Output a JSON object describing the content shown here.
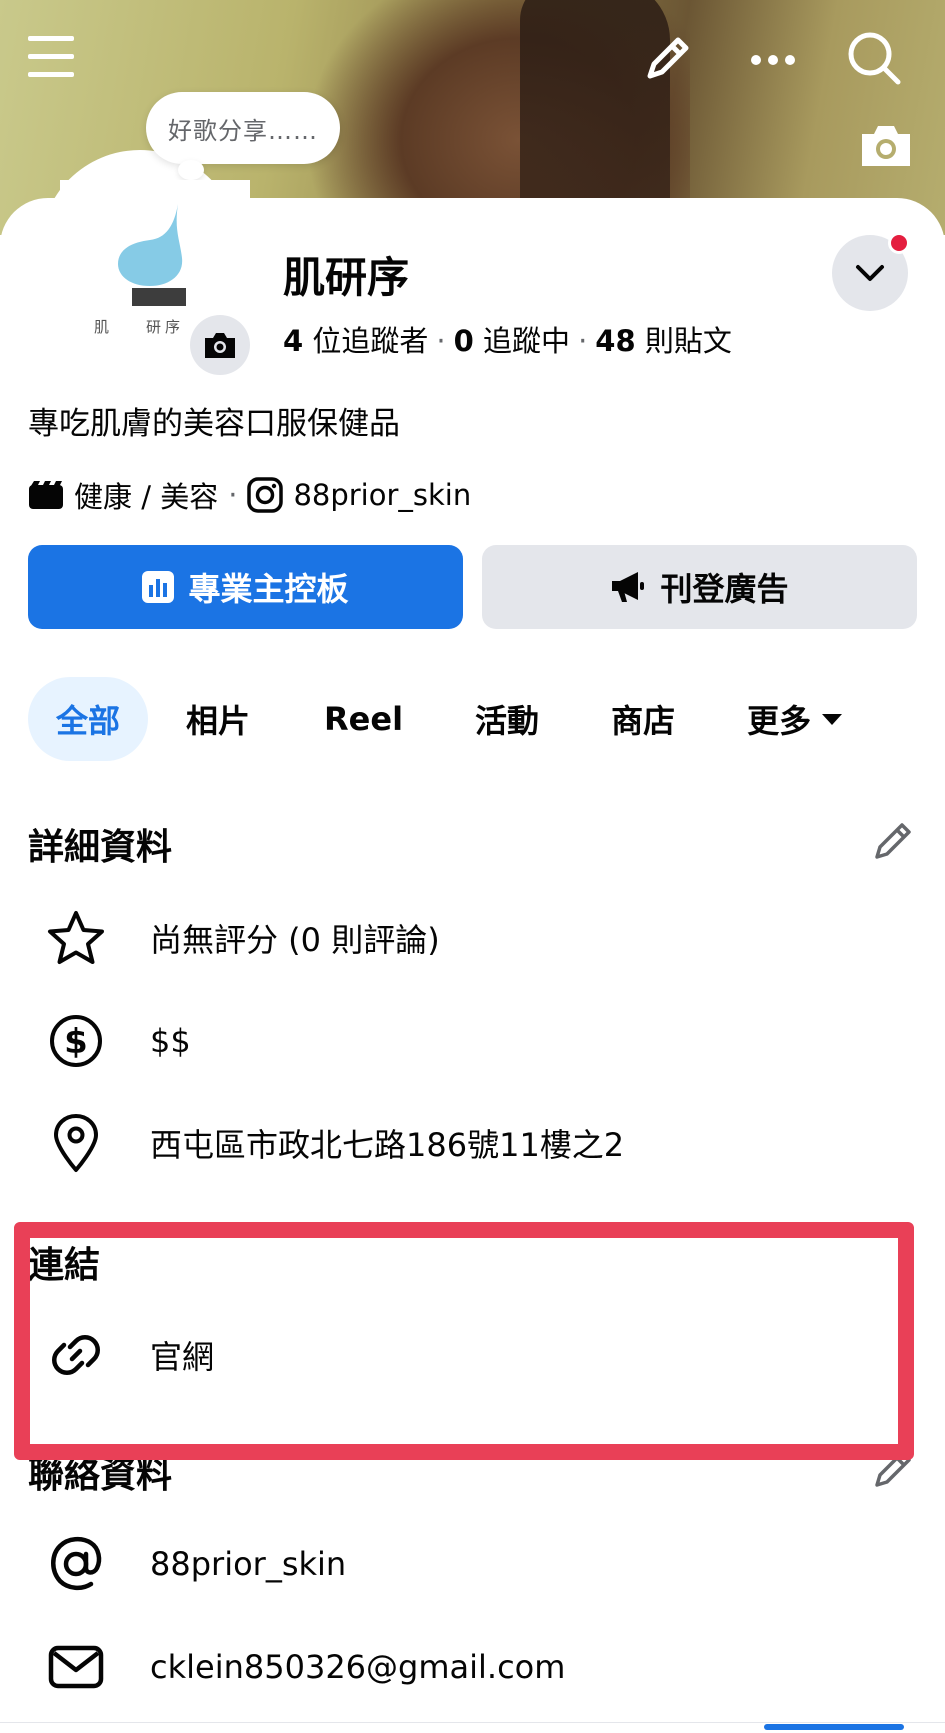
{
  "cover": {
    "bubble_text": "好歌分享……",
    "icons": [
      "menu-icon",
      "pencil-icon",
      "more-icon",
      "search-icon",
      "camera-icon"
    ]
  },
  "avatar": {
    "logo_left": "肌",
    "logo_right": "研序"
  },
  "profile": {
    "name": "肌研序",
    "followers_count": "4",
    "followers_label": "位追蹤者",
    "following_count": "0",
    "following_label": "追蹤中",
    "posts_count": "48",
    "posts_label": "則貼文",
    "bio": "專吃肌膚的美容口服保健品",
    "category": "健康 / 美容",
    "instagram": "88prior_skin"
  },
  "actions": {
    "primary_label": "專業主控板",
    "secondary_label": "刊登廣告"
  },
  "tabs": [
    {
      "label": "全部",
      "active": true
    },
    {
      "label": "相片"
    },
    {
      "label": "Reel"
    },
    {
      "label": "活動"
    },
    {
      "label": "商店"
    },
    {
      "label": "更多"
    }
  ],
  "details": {
    "title": "詳細資料",
    "rating": "尚無評分 (0 則評論)",
    "price": "$$",
    "address": "西屯區市政北七路186號11樓之2"
  },
  "links": {
    "title": "連結",
    "website": "官網"
  },
  "contact": {
    "title": "聯絡資料",
    "instagram": "88prior_skin",
    "email": "cklein850326@gmail.com"
  },
  "colors": {
    "accent": "#1b74e4",
    "highlight": "#e94057",
    "notification": "#e41e3f"
  }
}
